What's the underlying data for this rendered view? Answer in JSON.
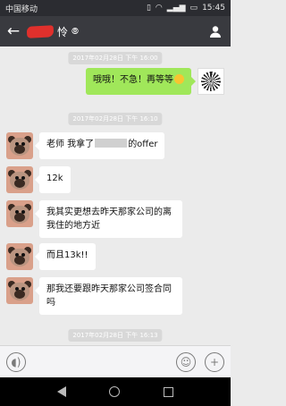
{
  "status": {
    "carrier": "中国移动",
    "time": "15:45"
  },
  "header": {
    "title_suffix": "怜"
  },
  "timestamps": [
    "2017年02月28日 下午 16:00",
    "2017年02月28日 下午 16:10",
    "2017年02月28日 下午 16:13"
  ],
  "messages": [
    {
      "from": "me",
      "text": "哦哦！不急！再等等"
    },
    {
      "from": "them",
      "pre": "老师 我拿了",
      "post": "的offer"
    },
    {
      "from": "them",
      "text": "12k"
    },
    {
      "from": "them",
      "text": "我其实更想去昨天那家公司的离我住的地方近"
    },
    {
      "from": "them",
      "text": "而且13k!!"
    },
    {
      "from": "them",
      "text": "那我还要跟昨天那家公司签合同吗"
    }
  ],
  "colors": {
    "header_bg": "#393a3f",
    "chat_bg": "#ebebeb",
    "bubble_green": "#a0e75a",
    "bubble_white": "#ffffff"
  }
}
